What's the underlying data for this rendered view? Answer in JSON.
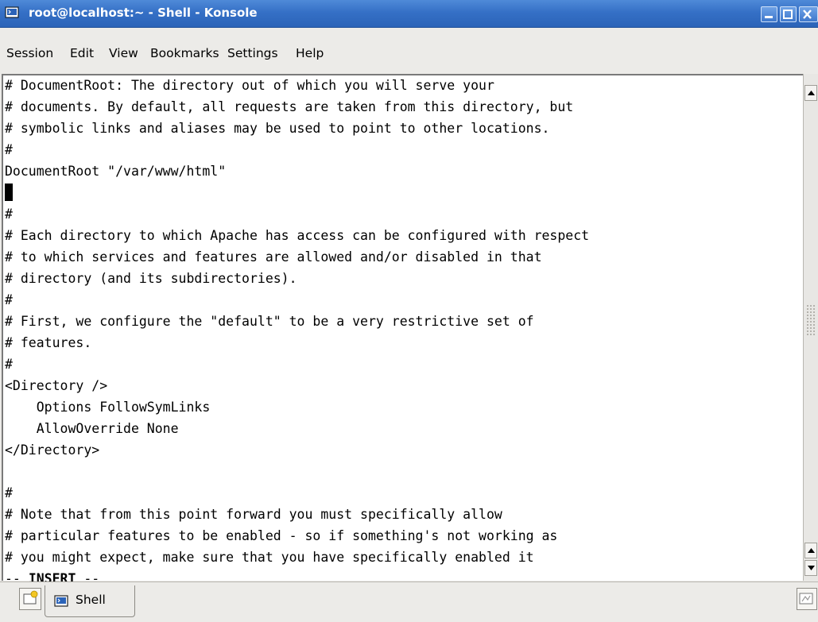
{
  "window": {
    "title": "root@localhost:~ - Shell - Konsole"
  },
  "menubar": {
    "items": [
      "Session",
      "Edit",
      "View",
      "Bookmarks",
      "Settings",
      "Help"
    ]
  },
  "terminal": {
    "lines": [
      "# DocumentRoot: The directory out of which you will serve your",
      "# documents. By default, all requests are taken from this directory, but",
      "# symbolic links and aliases may be used to point to other locations.",
      "#",
      "DocumentRoot \"/var/www/html\"",
      "",
      "#",
      "# Each directory to which Apache has access can be configured with respect",
      "# to which services and features are allowed and/or disabled in that",
      "# directory (and its subdirectories).",
      "#",
      "# First, we configure the \"default\" to be a very restrictive set of",
      "# features.",
      "#",
      "<Directory />",
      "    Options FollowSymLinks",
      "    AllowOverride None",
      "</Directory>",
      "",
      "#",
      "# Note that from this point forward you must specifically allow",
      "# particular features to be enabled - so if something's not working as",
      "# you might expect, make sure that you have specifically enabled it"
    ],
    "status_prefix": "-- ",
    "status_mode": "INSERT",
    "status_suffix": " --"
  },
  "tabbar": {
    "tabs": [
      {
        "label": "Shell"
      }
    ]
  },
  "icons": {
    "app": "terminal-icon",
    "minimize": "minimize-icon",
    "maximize": "maximize-icon",
    "close": "close-icon",
    "new_tab": "new-tab-icon",
    "close_tab": "close-tab-icon"
  },
  "colors": {
    "titlebar": "#3570c6",
    "terminal_bg": "#ffffff",
    "terminal_fg": "#000000"
  }
}
